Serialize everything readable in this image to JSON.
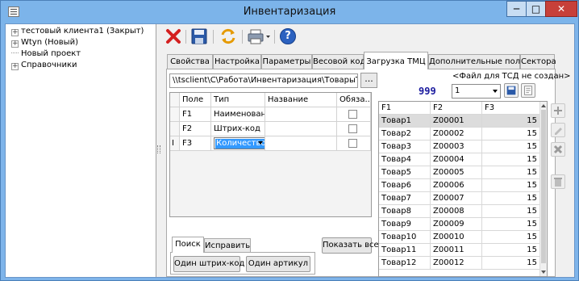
{
  "window": {
    "title": "Инвентаризация",
    "controls": {
      "minimize": "─",
      "maximize": "□",
      "close": "✕"
    }
  },
  "tree": {
    "items": [
      {
        "label": "тестовый клиента1 (Закрыт)",
        "expander": "+"
      },
      {
        "label": "Wtyn (Новый)",
        "expander": "+"
      },
      {
        "label": "Новый проект",
        "expander": ""
      },
      {
        "label": "Справочники",
        "expander": "+"
      }
    ]
  },
  "toolbar": {
    "icons": [
      "delete-icon",
      "save-icon",
      "refresh-icon",
      "print-icon",
      "help-icon"
    ],
    "help_label": "?"
  },
  "tabs": [
    {
      "label": "Свойства"
    },
    {
      "label": "Настройка"
    },
    {
      "label": "Параметры"
    },
    {
      "label": "Весовой код"
    },
    {
      "label": "Загрузка ТМЦ",
      "active": true
    },
    {
      "label": "Дополнительные поля"
    },
    {
      "label": "Сектора"
    }
  ],
  "import": {
    "file_path": "\\\\tsclient\\C\\Работа\\Инвентаризация\\ТоварыТест.xls",
    "browse_label": "...",
    "field_grid": {
      "headers": [
        "Поле",
        "Тип",
        "Название",
        "Обяза..."
      ],
      "current_row_marker": "I",
      "rows": [
        {
          "field": "F1",
          "type": "Наименование",
          "name": "",
          "required": false
        },
        {
          "field": "F2",
          "type": "Штрих-код",
          "name": "",
          "required": false
        },
        {
          "field": "F3",
          "type": "Количество",
          "name": "",
          "required": false
        }
      ]
    },
    "search_tabs": [
      {
        "label": "Поиск",
        "active": true
      },
      {
        "label": "Исправить"
      }
    ],
    "buttons": {
      "one_barcode": "Один штрих-код",
      "one_article": "Один артикул",
      "show_all": "Показать все"
    }
  },
  "tsd": {
    "file_note": "<Файл для ТСД не создан>",
    "count": "999",
    "selected": "1",
    "data_grid": {
      "headers": [
        "F1",
        "F2",
        "F3"
      ],
      "rows": [
        [
          "Товар1",
          "Z00001",
          "15"
        ],
        [
          "Товар2",
          "Z00002",
          "15"
        ],
        [
          "Товар3",
          "Z00003",
          "15"
        ],
        [
          "Товар4",
          "Z00004",
          "15"
        ],
        [
          "Товар5",
          "Z00005",
          "15"
        ],
        [
          "Товар6",
          "Z00006",
          "15"
        ],
        [
          "Товар7",
          "Z00007",
          "15"
        ],
        [
          "Товар8",
          "Z00008",
          "15"
        ],
        [
          "Товар9",
          "Z00009",
          "15"
        ],
        [
          "Товар10",
          "Z00010",
          "15"
        ],
        [
          "Товар11",
          "Z00011",
          "15"
        ],
        [
          "Товар12",
          "Z00012",
          "15"
        ]
      ]
    }
  },
  "side_actions": [
    "plus-icon",
    "edit-icon",
    "remove-icon",
    "trash-icon"
  ],
  "colors": {
    "titlebar": "#7cb4ea",
    "close_button": "#c7403a",
    "selection": "#3399ff",
    "count_text": "#1a1a9e"
  }
}
